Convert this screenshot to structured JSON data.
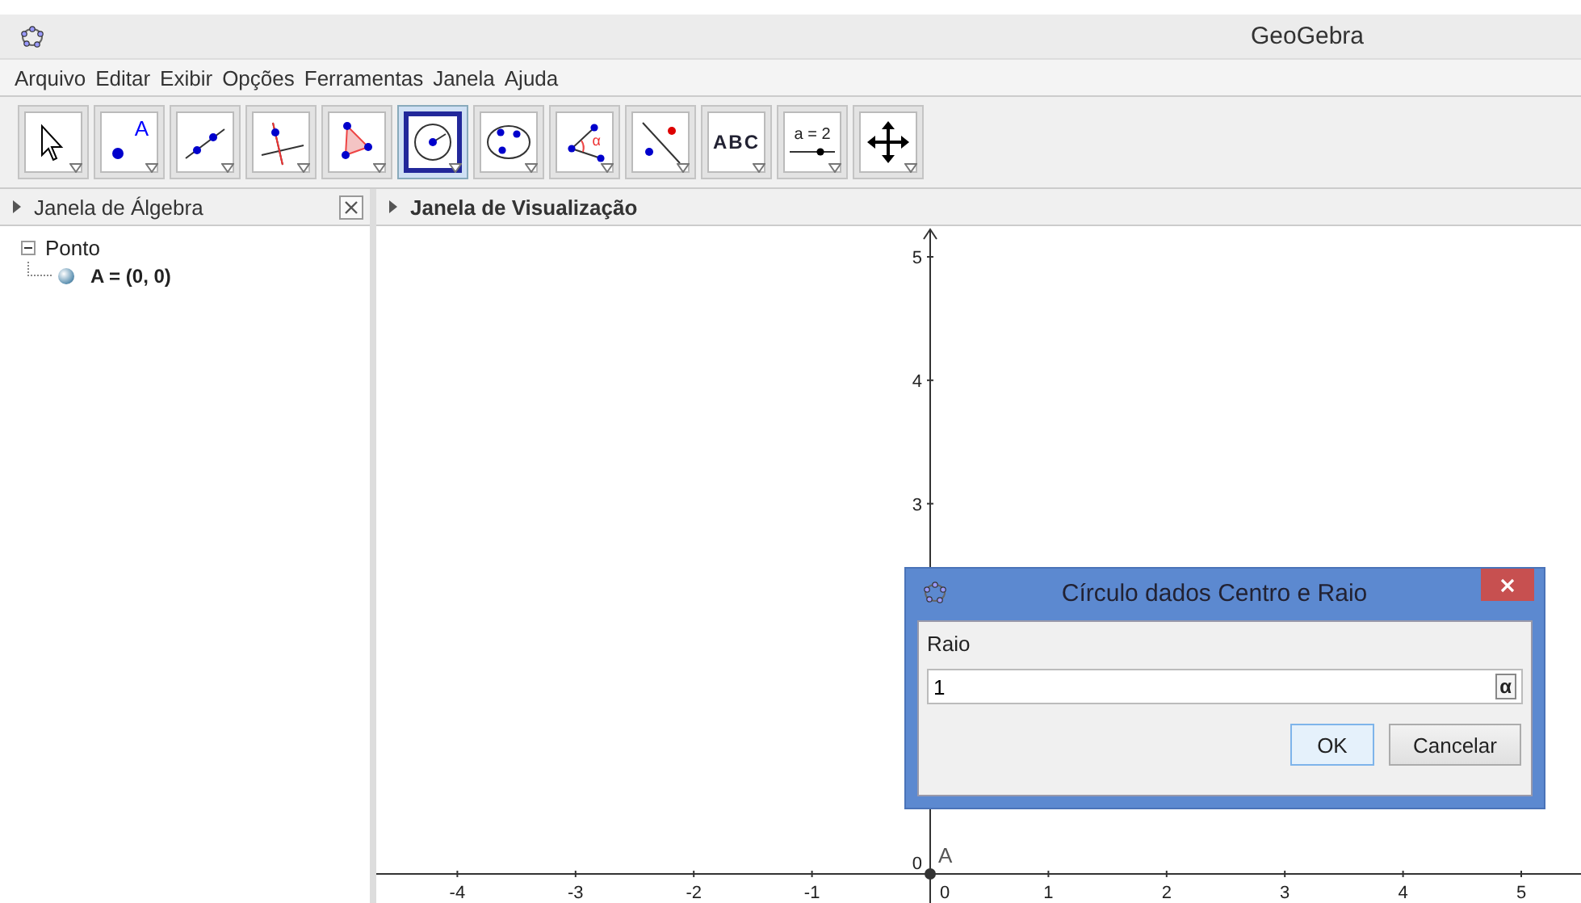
{
  "window": {
    "title": "GeoGebra"
  },
  "menu": [
    "Arquivo",
    "Editar",
    "Exibir",
    "Opções",
    "Ferramentas",
    "Janela",
    "Ajuda"
  ],
  "toolbar": [
    {
      "kind": "move",
      "selected": false
    },
    {
      "kind": "point",
      "label": "A",
      "selected": false
    },
    {
      "kind": "line",
      "selected": false
    },
    {
      "kind": "perpendicular",
      "selected": false
    },
    {
      "kind": "polygon",
      "selected": false
    },
    {
      "kind": "circle",
      "selected": true
    },
    {
      "kind": "conic",
      "selected": false
    },
    {
      "kind": "angle",
      "label": "α",
      "selected": false
    },
    {
      "kind": "reflect",
      "selected": false
    },
    {
      "kind": "text",
      "label": "ABC",
      "selected": false
    },
    {
      "kind": "slider",
      "label": "a = 2",
      "selected": false
    },
    {
      "kind": "pan",
      "selected": false
    }
  ],
  "algebra": {
    "title": "Janela de Álgebra",
    "tree": [
      {
        "label": "Ponto",
        "expanded": true,
        "children": [
          {
            "label": "A = (0, 0)"
          }
        ]
      }
    ]
  },
  "graphics": {
    "title": "Janela de Visualização",
    "x_labels": [
      "-4",
      "-3",
      "-2",
      "-1",
      "0",
      "1",
      "2",
      "3",
      "4",
      "5"
    ],
    "y_labels": [
      "5",
      "4",
      "3"
    ],
    "origin_label": "0",
    "point": {
      "label": "A"
    }
  },
  "dialog": {
    "title": "Círculo dados Centro e Raio",
    "field_label": "Raio",
    "value": "1",
    "symbol_button": "α",
    "buttons": [
      {
        "label": "OK",
        "default": true
      },
      {
        "label": "Cancelar",
        "default": false
      }
    ]
  }
}
